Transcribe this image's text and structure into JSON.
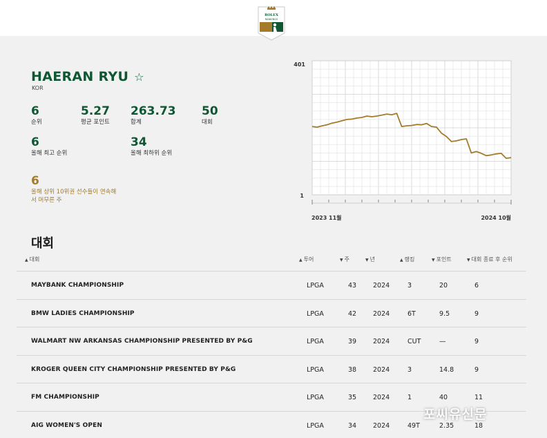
{
  "brand": {
    "logo_text_top": "ROLEX",
    "logo_text_bottom": "RANKINGS",
    "green": "#0f5733",
    "gold": "#a37b2a"
  },
  "player": {
    "name": "HAERAN RYU",
    "star": "☆",
    "country": "KOR"
  },
  "stats": [
    {
      "value": "6",
      "label": "순위"
    },
    {
      "value": "5.27",
      "label": "평균 포인트"
    },
    {
      "value": "263.73",
      "label": "합계"
    },
    {
      "value": "50",
      "label": "대회"
    },
    {
      "value": "6",
      "label": "올해 최고 순위"
    },
    {
      "value": "34",
      "label": "올해 최하위 순위"
    },
    {
      "value": "6",
      "label": "올해 상위 10위권 선수들이 연속해서 머무른 주"
    }
  ],
  "chart_data": {
    "type": "line",
    "y_top_label": "401",
    "y_bottom_label": "1",
    "ylim": [
      401,
      1
    ],
    "x_start_label": "2023 11월",
    "x_end_label": "2024 10월",
    "series": [
      {
        "color": "#a37b2a",
        "rank": [
          205,
          203,
          207,
          210,
          215,
          218,
          222,
          226,
          227,
          230,
          232,
          236,
          234,
          236,
          239,
          242,
          240,
          244,
          205,
          207,
          208,
          211,
          210,
          214,
          205,
          203,
          185,
          175,
          160,
          162,
          166,
          168,
          126,
          130,
          125,
          118,
          120,
          123,
          125,
          110,
          112
        ]
      }
    ],
    "grid": true
  },
  "tournaments": {
    "title": "대회",
    "columns": [
      "대회",
      "투어",
      "주",
      "년",
      "랭킹",
      "포인트",
      "대회 종료 후 순위"
    ],
    "rows": [
      {
        "name": "MAYBANK CHAMPIONSHIP",
        "tour": "LPGA",
        "week": "43",
        "year": "2024",
        "rank": "3",
        "points": "20",
        "after": "6"
      },
      {
        "name": "BMW LADIES CHAMPIONSHIP",
        "tour": "LPGA",
        "week": "42",
        "year": "2024",
        "rank": "6T",
        "points": "9.5",
        "after": "9"
      },
      {
        "name": "WALMART NW ARKANSAS CHAMPIONSHIP PRESENTED BY P&G",
        "tour": "LPGA",
        "week": "39",
        "year": "2024",
        "rank": "CUT",
        "points": "—",
        "after": "9"
      },
      {
        "name": "KROGER QUEEN CITY CHAMPIONSHIP PRESENTED BY P&G",
        "tour": "LPGA",
        "week": "38",
        "year": "2024",
        "rank": "3",
        "points": "14.8",
        "after": "9"
      },
      {
        "name": "FM CHAMPIONSHIP",
        "tour": "LPGA",
        "week": "35",
        "year": "2024",
        "rank": "1",
        "points": "40",
        "after": "11"
      },
      {
        "name": "AIG WOMEN'S OPEN",
        "tour": "LPGA",
        "week": "34",
        "year": "2024",
        "rank": "49T",
        "points": "2.35",
        "after": "18"
      }
    ]
  },
  "watermark": "포씨유신문"
}
